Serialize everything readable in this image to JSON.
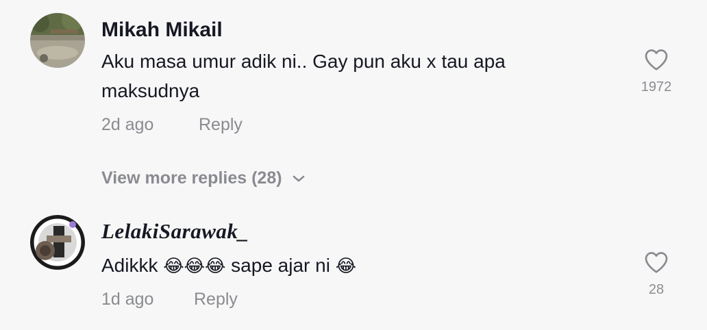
{
  "comments": [
    {
      "username": "Mikah Mikail",
      "text": "Aku masa umur adik ni.. Gay pun aku x tau apa maksudnya",
      "time": "2d ago",
      "reply_label": "Reply",
      "likes": "1972"
    },
    {
      "username": "LelakiSarawak_",
      "text_parts": [
        "Adikkk ",
        "😂😂😂",
        " sape ajar ni ",
        "😂"
      ],
      "time": "1d ago",
      "reply_label": "Reply",
      "likes": "28"
    }
  ],
  "view_more_label": "View more replies (28)",
  "icons": {
    "like": "heart-outline-icon",
    "expand": "chevron-down-icon"
  },
  "colors": {
    "background": "#f7f7f7",
    "text": "#161823",
    "muted": "#8a8b91"
  }
}
